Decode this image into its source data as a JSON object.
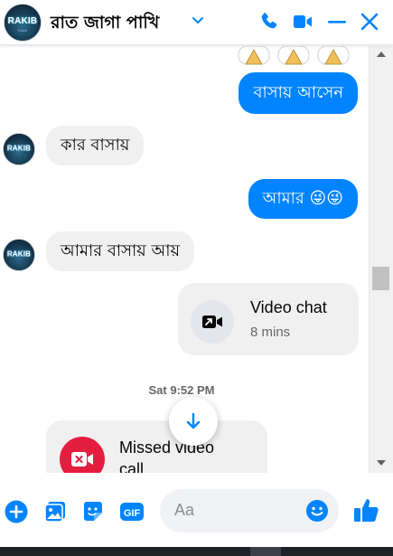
{
  "header": {
    "contact_name": "রাত জাগা পাখি",
    "avatar_text": "RAKIB",
    "avatar_subtext": "Rakib",
    "accent_color": "#0084ff"
  },
  "messages": [
    {
      "direction": "outgoing",
      "text": "বাসায় আসেন"
    },
    {
      "direction": "incoming",
      "text": "কার বাসায়"
    },
    {
      "direction": "outgoing",
      "text": "আমার 😜😜"
    },
    {
      "direction": "incoming",
      "text": "আমার বাসায় আয়"
    }
  ],
  "calls": [
    {
      "title": "Video chat",
      "subtitle": "8 mins",
      "icon": "video-chat-icon"
    },
    {
      "title": "Missed video call",
      "title_line1": "Missed video",
      "title_line2": "call",
      "icon": "missed-video-call-icon"
    }
  ],
  "timestamp": "Sat 9:52 PM",
  "composer": {
    "placeholder": "Aa"
  },
  "colors": {
    "outgoing_bubble": "#0084ff",
    "incoming_bubble": "#f0f0f0",
    "missed_call": "#e41e3f"
  }
}
